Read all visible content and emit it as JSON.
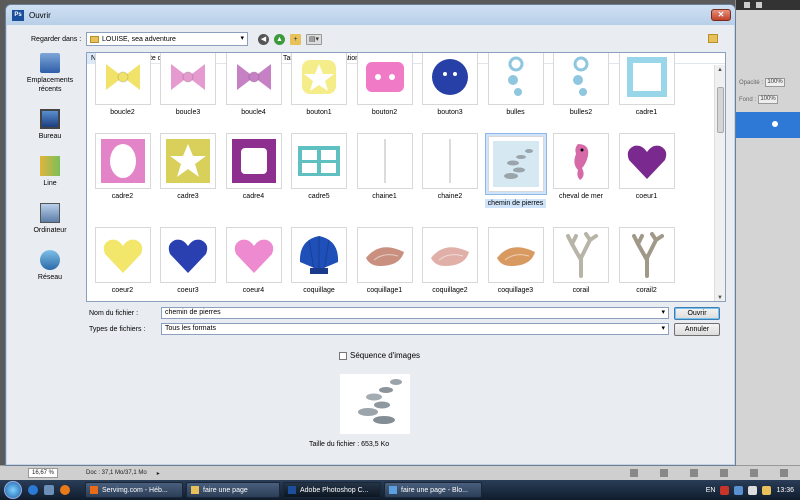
{
  "window": {
    "title": "Ouvrir",
    "close_label": "✕"
  },
  "lookin": {
    "label": "Regarder dans :",
    "value": "LOUISE, sea adventure"
  },
  "places": [
    {
      "label": "Emplacements récents",
      "icon": "recent-places-icon"
    },
    {
      "label": "Bureau",
      "icon": "desktop-icon"
    },
    {
      "label": "Line",
      "icon": "libraries-icon"
    },
    {
      "label": "Ordinateur",
      "icon": "computer-icon"
    },
    {
      "label": "Réseau",
      "icon": "network-icon"
    }
  ],
  "columns": [
    {
      "label": "Nom"
    },
    {
      "label": "Date de la prise de vue"
    },
    {
      "label": "Mots-clés"
    },
    {
      "label": "Taille"
    },
    {
      "label": "Notation"
    }
  ],
  "files": [
    {
      "name": "boucle2",
      "thumb": "bow",
      "color": "#f1e26a"
    },
    {
      "name": "boucle3",
      "thumb": "bow",
      "color": "#e59ad0"
    },
    {
      "name": "boucle4",
      "thumb": "bow",
      "color": "#c680c4"
    },
    {
      "name": "bouton1",
      "thumb": "star-button",
      "color": "#f4ed8a"
    },
    {
      "name": "bouton2",
      "thumb": "pink-button",
      "color": "#f07ac6"
    },
    {
      "name": "bouton3",
      "thumb": "blue-button",
      "color": "#2740a8"
    },
    {
      "name": "bulles",
      "thumb": "bubbles",
      "color": "#8fc6e0"
    },
    {
      "name": "bulles2",
      "thumb": "bubbles",
      "color": "#8fc6e0"
    },
    {
      "name": "cadre1",
      "thumb": "frame-blue",
      "color": "#9ad6ea"
    },
    {
      "name": "cadre2",
      "thumb": "frame-pink",
      "color": "#e384c8"
    },
    {
      "name": "cadre3",
      "thumb": "frame-star",
      "color": "#d8d05a"
    },
    {
      "name": "cadre4",
      "thumb": "frame-purple",
      "color": "#8c2f8e"
    },
    {
      "name": "cadre5",
      "thumb": "frame-window",
      "color": "#5ec0c0"
    },
    {
      "name": "chaine1",
      "thumb": "chain",
      "color": "#cfcfcf"
    },
    {
      "name": "chaine2",
      "thumb": "chain",
      "color": "#cfcfcf"
    },
    {
      "name": "chemin de pierres",
      "thumb": "stones",
      "color": "#9aa4aa"
    },
    {
      "name": "cheval de mer",
      "thumb": "seahorse",
      "color": "#d66aa8"
    },
    {
      "name": "coeur1",
      "thumb": "heart",
      "color": "#7a2a8e"
    },
    {
      "name": "coeur2",
      "thumb": "heart",
      "color": "#f2e76a"
    },
    {
      "name": "coeur3",
      "thumb": "heart",
      "color": "#2a40b0"
    },
    {
      "name": "coeur4",
      "thumb": "heart",
      "color": "#ee8ad0"
    },
    {
      "name": "coquillage",
      "thumb": "shell-blue",
      "color": "#1f4fb8"
    },
    {
      "name": "coquillage1",
      "thumb": "conch",
      "color": "#c99080"
    },
    {
      "name": "coquillage2",
      "thumb": "conch",
      "color": "#e0b0a8"
    },
    {
      "name": "coquillage3",
      "thumb": "conch",
      "color": "#d89a60"
    },
    {
      "name": "corail",
      "thumb": "coral",
      "color": "#b8b4a8"
    },
    {
      "name": "corail2",
      "thumb": "coral",
      "color": "#a09888"
    }
  ],
  "selected_file": "chemin de pierres",
  "filename": {
    "label": "Nom du fichier :",
    "value": "chemin de pierres"
  },
  "filetype": {
    "label": "Types de fichiers :",
    "value": "Tous les formats"
  },
  "buttons": {
    "open": "Ouvrir",
    "cancel": "Annuler"
  },
  "sequence": {
    "label": "Séquence d'images",
    "checked": false
  },
  "filesize": "Taille du fichier : 653,5 Ko",
  "ps": {
    "opacity_label": "Opacité :",
    "opacity_value": "100%",
    "fill_label": "Fond :",
    "fill_value": "100%",
    "zoom": "16,67 %",
    "doc": "Doc : 37,1 Mo/37,1 Mo",
    "arrow": "▸"
  },
  "taskbar": {
    "tasks": [
      {
        "label": "Servimg.com - Héb...",
        "icon_color": "#e86b1a"
      },
      {
        "label": "faire une page",
        "icon_color": "#e8c15a"
      },
      {
        "label": "Adobe Photoshop C...",
        "icon_color": "#1b4f9c",
        "active": true
      },
      {
        "label": "faire une page - Blo...",
        "icon_color": "#5aa0e0"
      }
    ],
    "lang": "EN",
    "clock": "13:36"
  }
}
